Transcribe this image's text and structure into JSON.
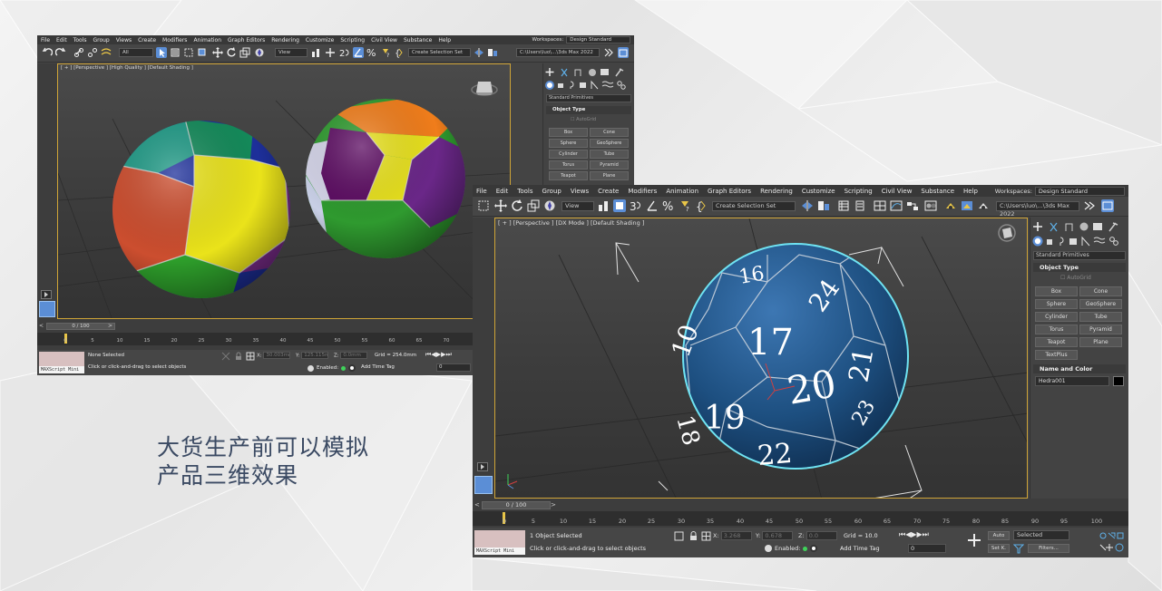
{
  "caption": {
    "line1": "大货生产前可以模拟",
    "line2": "产品三维效果"
  },
  "window1": {
    "menu": [
      "File",
      "Edit",
      "Tools",
      "Group",
      "Views",
      "Create",
      "Modifiers",
      "Animation",
      "Graph Editors",
      "Rendering",
      "Customize",
      "Scripting",
      "Civil View",
      "Substance",
      "Help"
    ],
    "workspace_label": "Workspaces:",
    "workspace_value": "Design Standard",
    "filter_value": "All",
    "view_value": "View",
    "selection_set": "Create Selection Set",
    "path": "C:\\Users\\luo\\...\\3ds Max 2022",
    "viewport_label": "[ + ] [Perspective ] [High Quality ] [Default Shading ]",
    "category": "Standard Primitives",
    "object_type_title": "Object Type",
    "autogrid": "AutoGrid",
    "primitives": [
      "Box",
      "Cone",
      "Sphere",
      "GeoSphere",
      "Cylinder",
      "Tube",
      "Torus",
      "Pyramid",
      "Teapot",
      "Plane"
    ],
    "slider": "0 / 100",
    "ticks": [
      "0",
      "5",
      "10",
      "15",
      "20",
      "25",
      "30",
      "35",
      "40",
      "45",
      "50",
      "55",
      "60",
      "65",
      "70"
    ],
    "maxscript": "MAXScript Mini",
    "status_selected": "None Selected",
    "status_prompt": "Click or click-and-drag to select objects",
    "x_label": "X:",
    "x_value": "30.003mm",
    "y_label": "Y:",
    "y_value": "125.115mm",
    "z_label": "Z:",
    "z_value": "0.0mm",
    "grid": "Grid = 254.0mm",
    "enabled": "Enabled:",
    "add_time_tag": "Add Time Tag",
    "frame": "0"
  },
  "window2": {
    "menu": [
      "File",
      "Edit",
      "Tools",
      "Group",
      "Views",
      "Create",
      "Modifiers",
      "Animation",
      "Graph Editors",
      "Rendering",
      "Customize",
      "Scripting",
      "Civil View",
      "Substance",
      "Help"
    ],
    "workspace_label": "Workspaces:",
    "workspace_value": "Design Standard",
    "view_value": "View",
    "selection_set": "Create Selection Set",
    "path": "C:\\Users\\luo\\...\\3ds Max 2022",
    "viewport_label": "[ + ] [Perspective ] [DX Mode ] [Default Shading ]",
    "category": "Standard Primitives",
    "object_type_title": "Object Type",
    "autogrid": "AutoGrid",
    "primitives": [
      "Box",
      "Cone",
      "Sphere",
      "GeoSphere",
      "Cylinder",
      "Tube",
      "Torus",
      "Pyramid",
      "Teapot",
      "Plane",
      "TextPlus"
    ],
    "name_color_title": "Name and Color",
    "object_name": "Hedra001",
    "object_color": "#000000",
    "slider": "0 / 100",
    "ticks": [
      "0",
      "5",
      "10",
      "15",
      "20",
      "25",
      "30",
      "35",
      "40",
      "45",
      "50",
      "55",
      "60",
      "65",
      "70",
      "75",
      "80",
      "85",
      "90",
      "95",
      "100"
    ],
    "maxscript": "MAXScript Mini",
    "status_selected": "1 Object Selected",
    "status_prompt": "Click or click-and-drag to select objects",
    "x_label": "X:",
    "x_value": "3.268",
    "y_label": "Y:",
    "y_value": "0.678",
    "z_label": "Z:",
    "z_value": "0.0",
    "grid": "Grid = 10.0",
    "enabled": "Enabled:",
    "add_time_tag": "Add Time Tag",
    "frame": "0",
    "auto": "Auto",
    "setkey": "Set K.",
    "key_mode": "Selected",
    "filters": "Filters...",
    "die_numbers": [
      "16",
      "17",
      "24",
      "10",
      "21",
      "20",
      "19",
      "18",
      "22",
      "23"
    ]
  },
  "colors": {
    "caption": "#3b4a63",
    "viewport_border": "#cfa437",
    "die_blue": "#1d4f80",
    "die_outline": "#6fe3f2"
  }
}
